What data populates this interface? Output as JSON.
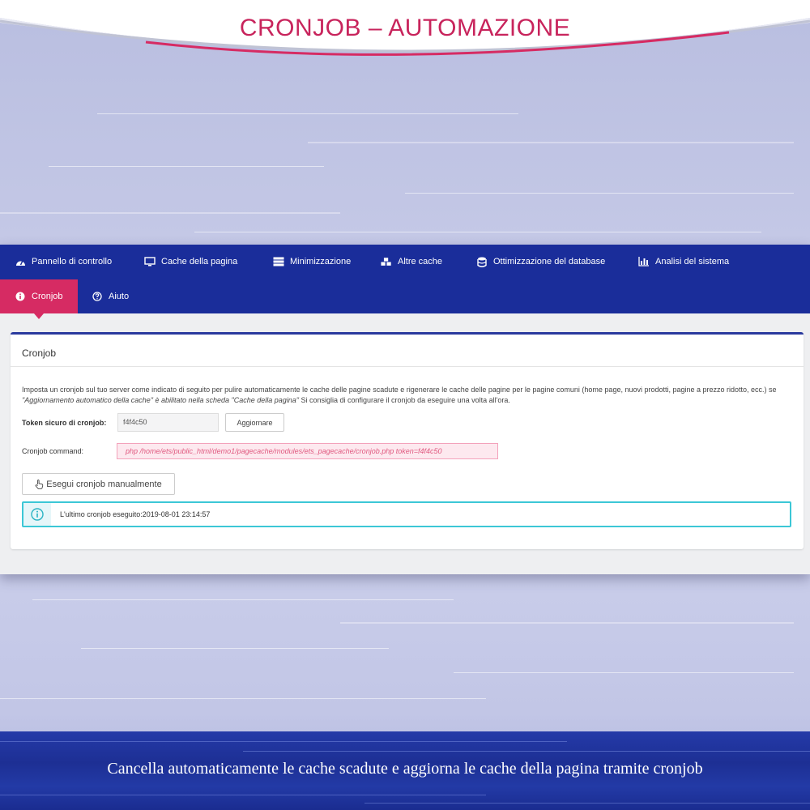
{
  "header": {
    "title": "CRONJOB – AUTOMAZIONE"
  },
  "nav": {
    "row1": [
      {
        "label": "Pannello di controllo",
        "icon": "dashboard-icon"
      },
      {
        "label": "Cache della pagina",
        "icon": "monitor-icon"
      },
      {
        "label": "Minimizzazione",
        "icon": "server-icon"
      },
      {
        "label": "Altre cache",
        "icon": "cubes-icon"
      },
      {
        "label": "Ottimizzazione del database",
        "icon": "database-icon"
      },
      {
        "label": "Analisi del sistema",
        "icon": "bar-chart-icon"
      }
    ],
    "row2": [
      {
        "label": "Cronjob",
        "icon": "info-circle-icon",
        "active": true
      },
      {
        "label": "Aiuto",
        "icon": "question-circle-icon"
      }
    ]
  },
  "card": {
    "title": "Cronjob",
    "description_pre": "Imposta un cronjob sul tuo server come indicato di seguito per pulire automaticamente le cache delle pagine scadute e rigenerare le cache delle pagine per le pagine comuni (home page, nuovi prodotti, pagine a prezzo ridotto, ecc.) se ",
    "description_em1": "\"Aggiornamento automatico della cache\" è abilitato nella scheda \"Cache della pagina\"",
    "description_post": " Si consiglia di configurare il cronjob da eseguire una volta all'ora.",
    "token_label": "Token sicuro di cronjob:",
    "token_value": "f4f4c50",
    "update_button": "Aggiornare",
    "command_label": "Cronjob command:",
    "command_value": "php /home/ets/public_html/demo1/pagecache/modules/ets_pagecache/cronjob.php token=f4f4c50",
    "run_button": "Esegui cronjob manualmente",
    "last_run_text": "L'ultimo cronjob eseguito:2019-08-01 23:14:57"
  },
  "footer": {
    "caption": "Cancella automaticamente le cache scadute e aggiorna le cache della pagina tramite cronjob"
  },
  "colors": {
    "accent_pink": "#d62b63",
    "nav_blue": "#1a2d9a",
    "info_teal": "#3cc7d6"
  }
}
